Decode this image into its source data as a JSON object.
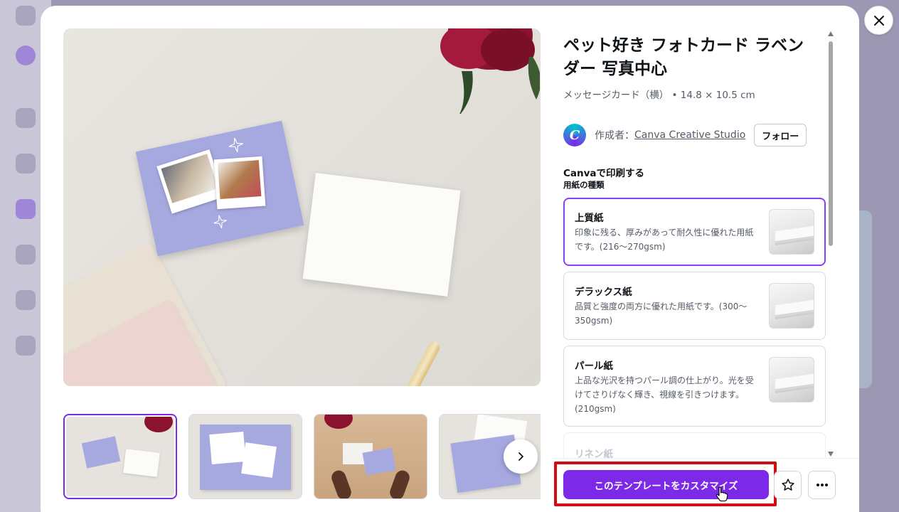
{
  "modal": {
    "title": "ペット好き フォトカード ラベンダー 写真中心",
    "subtitle": "メッセージカード（横） • 14.8 × 10.5 cm",
    "creator": {
      "label": "作成者：",
      "name": "Canva Creative Studio",
      "avatar_letter": "C",
      "follow_label": "フォロー"
    },
    "print_heading": "Canvaで印刷する",
    "paper_heading": "用紙の種類",
    "paper_options": [
      {
        "name": "上質紙",
        "description": "印象に残る、厚みがあって耐久性に優れた用紙です。(216〜270gsm)",
        "selected": true
      },
      {
        "name": "デラックス紙",
        "description": "品質と強度の両方に優れた用紙です。(300〜350gsm)",
        "selected": false
      },
      {
        "name": "パール紙",
        "description": "上品な光沢を持つパール調の仕上がり。光を受けてさりげなく輝き、視線を引きつけます。(210gsm)",
        "selected": false
      },
      {
        "name": "リネン紙",
        "description": "",
        "selected": false
      }
    ],
    "customize_label": "このテンプレートをカスタマイズ",
    "thumbnails_count": 4,
    "selected_thumbnail": 1
  },
  "colors": {
    "accent": "#7d2ae8",
    "highlight": "#d20a11",
    "overlay": "#8e8aa6"
  },
  "icons": {
    "close": "close-icon",
    "next": "chevron-right-icon",
    "star": "star-icon",
    "more": "more-horizontal-icon"
  }
}
